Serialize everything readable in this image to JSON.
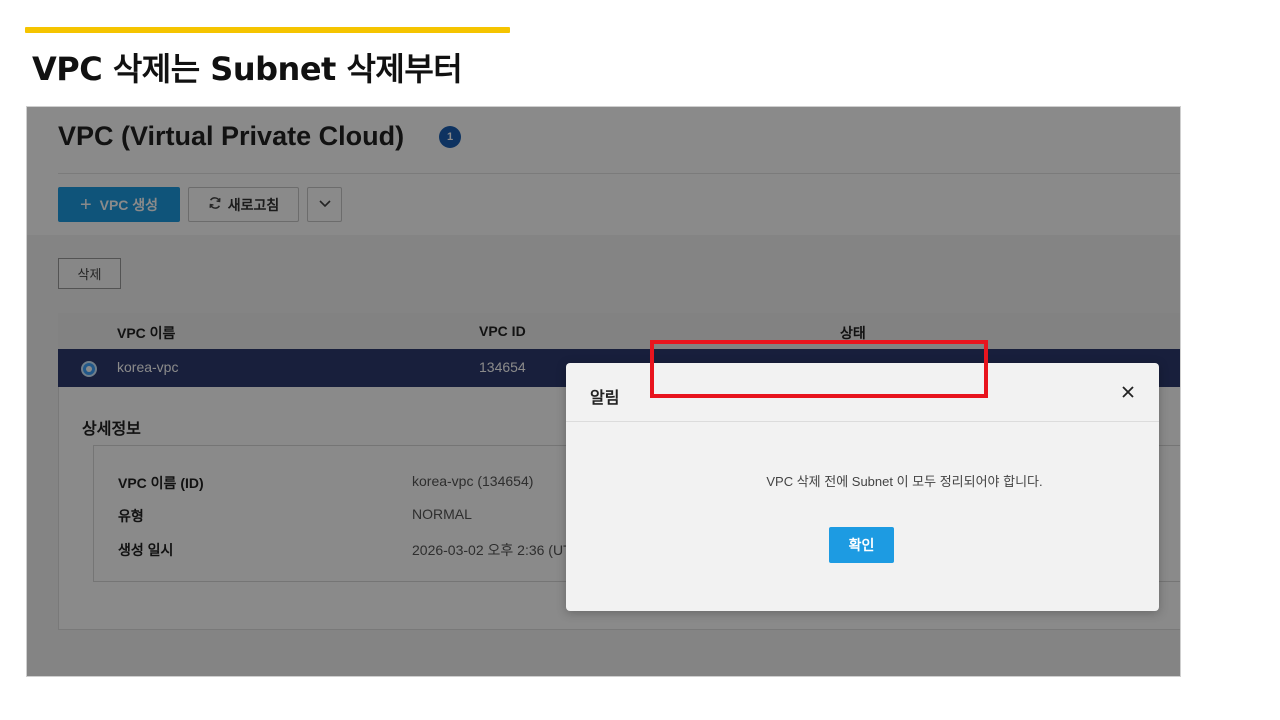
{
  "slide": {
    "title": "VPC 삭제는 Subnet 삭제부터"
  },
  "header": {
    "page_title": "VPC (Virtual Private Cloud)",
    "info_badge": "1",
    "create_button": "VPC 생성",
    "refresh_button": "새로고침"
  },
  "toolbar": {
    "delete_button": "삭제"
  },
  "table": {
    "columns": [
      "VPC 이름",
      "VPC ID",
      "상태"
    ],
    "rows": [
      {
        "name": "korea-vpc",
        "id": "134654",
        "status": ""
      }
    ]
  },
  "details": {
    "title": "상세정보",
    "fields": [
      {
        "label": "VPC 이름 (ID)",
        "value": "korea-vpc (134654)"
      },
      {
        "label": "유형",
        "value": "NORMAL"
      },
      {
        "label": "생성 일시",
        "value": "2026-03-02 오후 2:36 (UT"
      }
    ]
  },
  "modal": {
    "title": "알림",
    "message": "VPC 삭제 전에 Subnet 이 모두 정리되어야 합니다.",
    "confirm_button": "확인"
  },
  "colors": {
    "accent_bar": "#f5c400",
    "primary_button": "#1d9be2",
    "selected_row": "#2d3a70",
    "highlight_box": "#e8141e"
  }
}
